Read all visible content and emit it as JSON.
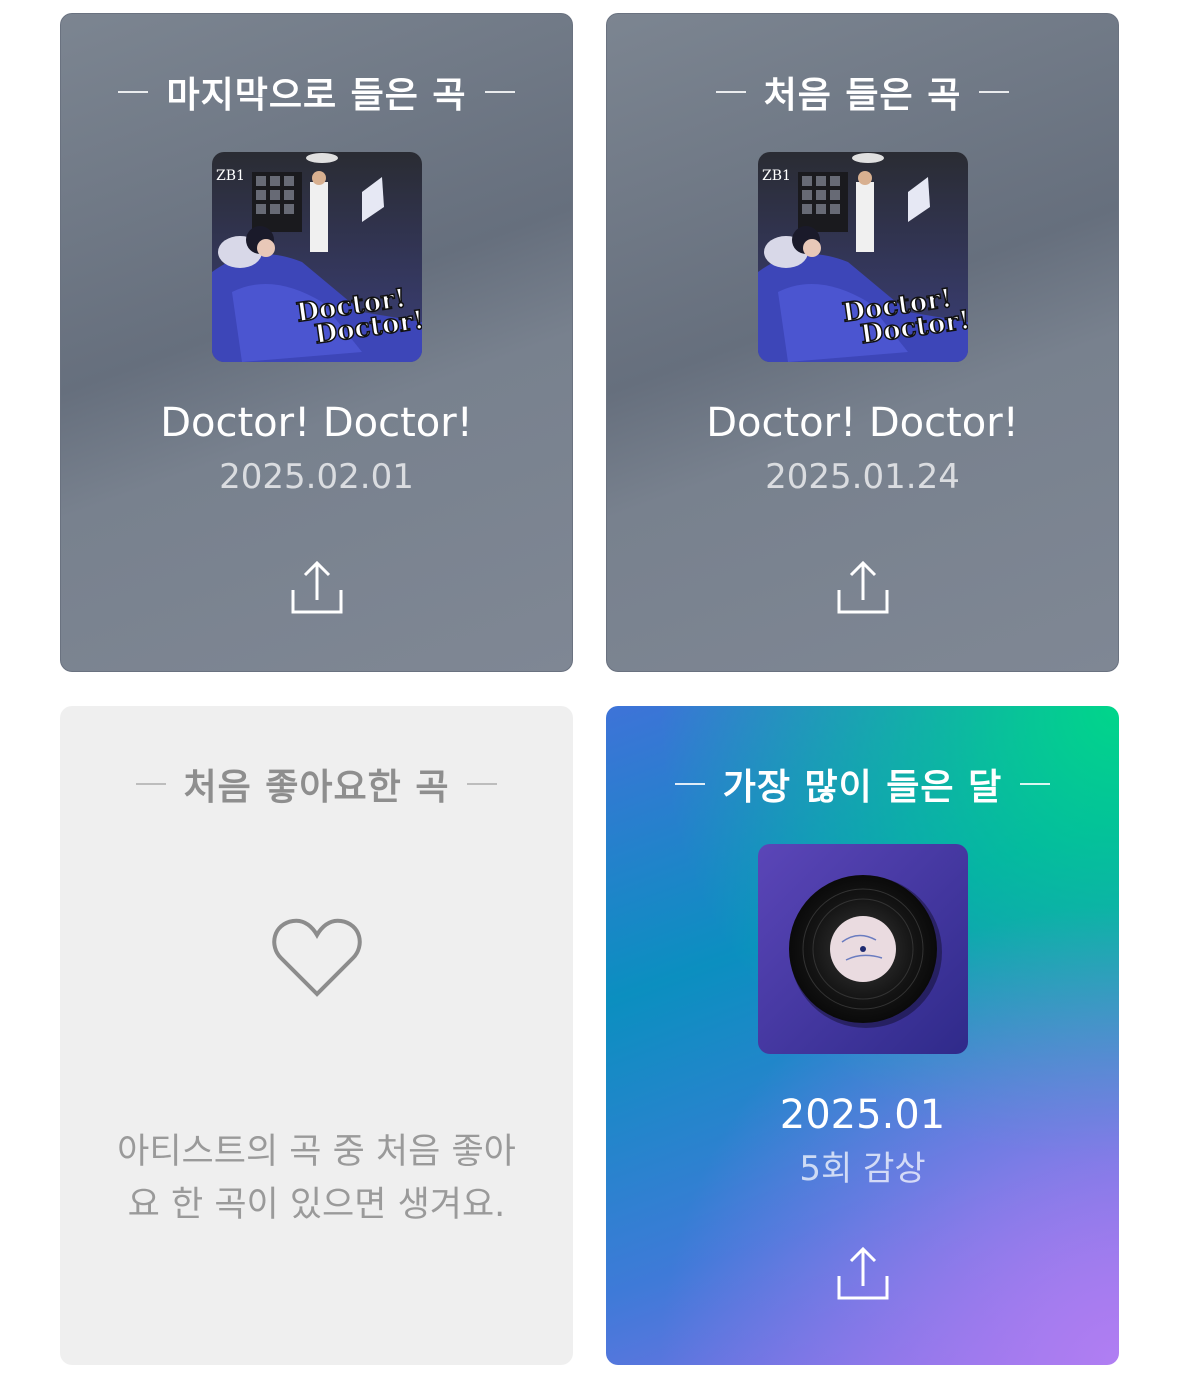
{
  "cards": {
    "last_played": {
      "title": "마지막으로 들은 곡",
      "song": "Doctor! Doctor!",
      "date": "2025.02.01",
      "art_text": [
        "Doctor!",
        "Doctor!"
      ],
      "art_logo": "ZB1",
      "share_icon": "share-icon"
    },
    "first_played": {
      "title": "처음 들은 곡",
      "song": "Doctor! Doctor!",
      "date": "2025.01.24",
      "art_text": [
        "Doctor!",
        "Doctor!"
      ],
      "art_logo": "ZB1",
      "share_icon": "share-icon"
    },
    "first_liked": {
      "title": "처음 좋아요한 곡",
      "icon": "heart-icon",
      "empty_message": "아티스트의 곡 중 처음 좋아요 한 곡이 있으면 생겨요."
    },
    "most_played_month": {
      "title": "가장 많이 들은 달",
      "month": "2025.01",
      "count": "5회 감상",
      "share_icon": "share-icon"
    }
  },
  "colors": {
    "gray_card": "#6f7886",
    "light_card": "#efefef",
    "gradient_start": "#00d68a",
    "gradient_end": "#b07ef2"
  }
}
